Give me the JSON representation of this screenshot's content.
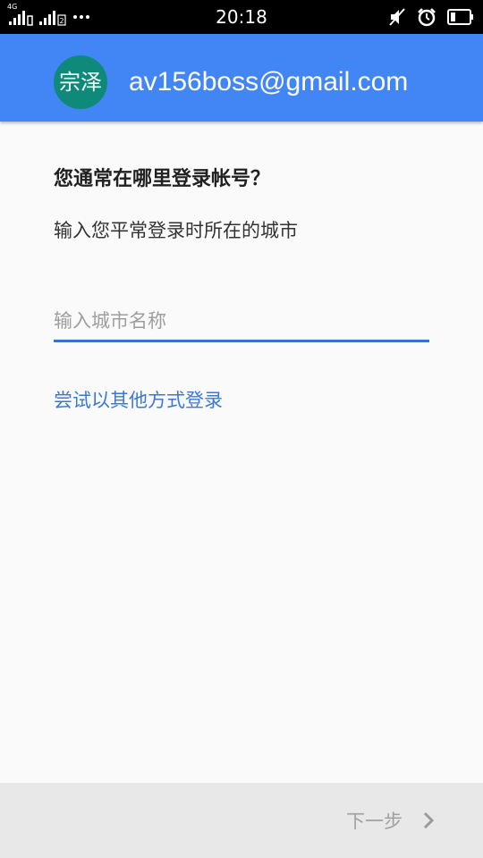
{
  "status_bar": {
    "network_label": "4G",
    "time": "20:18",
    "colors": {
      "background": "#000000",
      "foreground": "#ffffff"
    },
    "left_icons": [
      "signal-icon",
      "sim2-signal-icon",
      "more-dots-icon"
    ],
    "right_icons": [
      "mute-icon",
      "alarm-icon",
      "battery-icon"
    ]
  },
  "header": {
    "avatar_text": "宗泽",
    "account_email": "av156boss@gmail.com",
    "colors": {
      "background": "#4285f4",
      "avatar": "#0f8a7a"
    }
  },
  "content": {
    "question": "您通常在哪里登录帐号？",
    "description": "输入您平常登录时所在的城市",
    "city_input": {
      "value": "",
      "placeholder": "输入城市名称"
    },
    "alt_login_link": "尝试以其他方式登录",
    "colors": {
      "link": "#3b78d8",
      "input_underline": "#3b6fd1"
    }
  },
  "footer": {
    "next_label": "下一步",
    "next_icon": "chevron-right-icon"
  }
}
